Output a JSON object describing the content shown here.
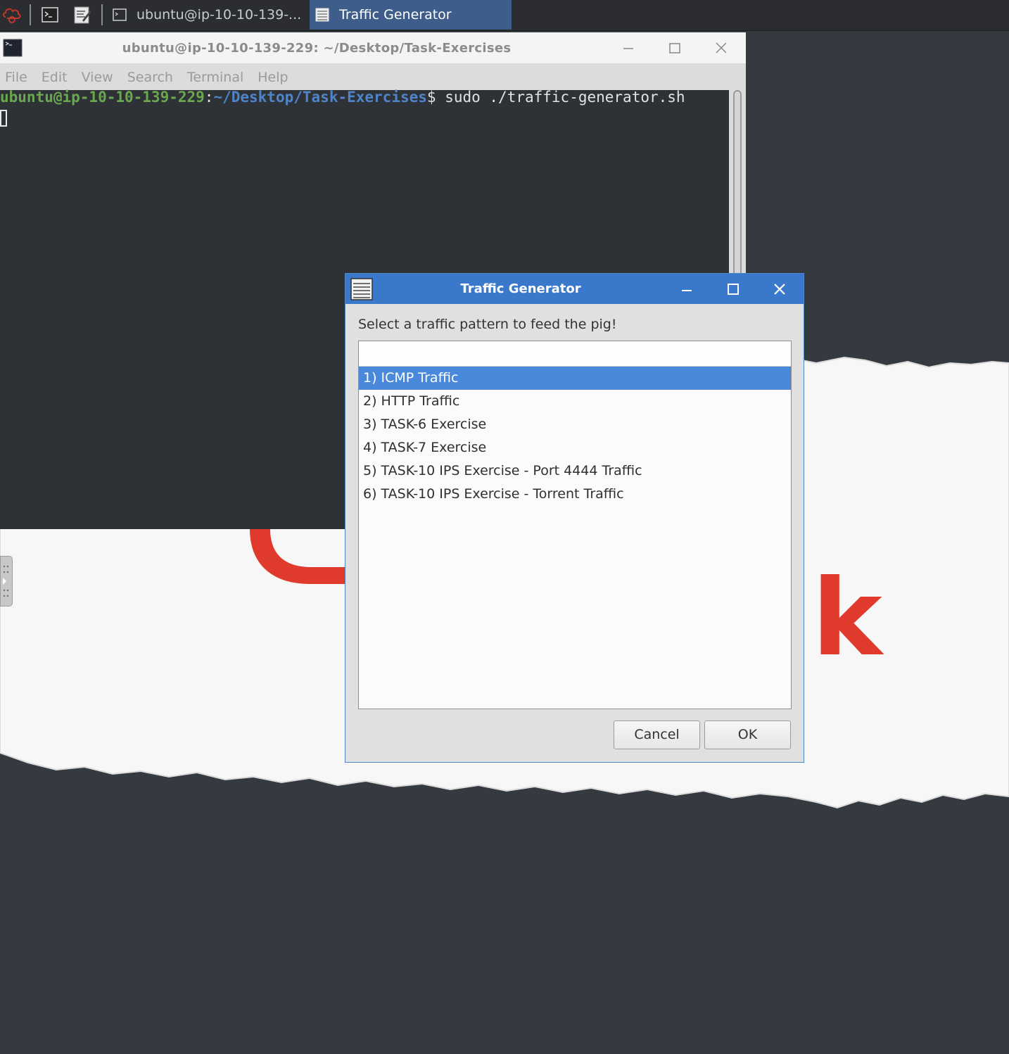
{
  "taskbar": {
    "tasks": [
      {
        "label": "ubuntu@ip-10-10-139-...",
        "icon": "terminal-icon"
      },
      {
        "label": "Traffic Generator",
        "icon": "list-window-icon"
      }
    ]
  },
  "terminal": {
    "title": "ubuntu@ip-10-10-139-229: ~/Desktop/Task-Exercises",
    "menu": [
      "File",
      "Edit",
      "View",
      "Search",
      "Terminal",
      "Help"
    ],
    "prompt_user": "ubuntu@ip-10-10-139-229",
    "prompt_sep": ":",
    "prompt_path": "~/Desktop/Task-Exercises",
    "prompt_symbol": "$",
    "command": " sudo ./traffic-generator.sh"
  },
  "dialog": {
    "title": "Traffic Generator",
    "prompt": "Select a traffic pattern to feed the pig!",
    "options": [
      "1) ICMP Traffic",
      "2) HTTP Traffic",
      "3) TASK-6 Exercise",
      "4) TASK-7 Exercise",
      "5) TASK-10 IPS Exercise - Port 4444 Traffic",
      "6) TASK-10 IPS Exercise - Torrent Traffic"
    ],
    "selected_index": 0,
    "cancel_label": "Cancel",
    "ok_label": "OK"
  },
  "wallpaper": {
    "visible_letter": "k"
  },
  "colors": {
    "taskbar_bg": "#2b2d30",
    "desktop_bg": "#353a40",
    "dialog_titlebar": "#3a78cc",
    "selection": "#4a88db",
    "prompt_user": "#6aa84f",
    "prompt_path": "#4e84c9",
    "logo_red": "#e03a2c"
  }
}
